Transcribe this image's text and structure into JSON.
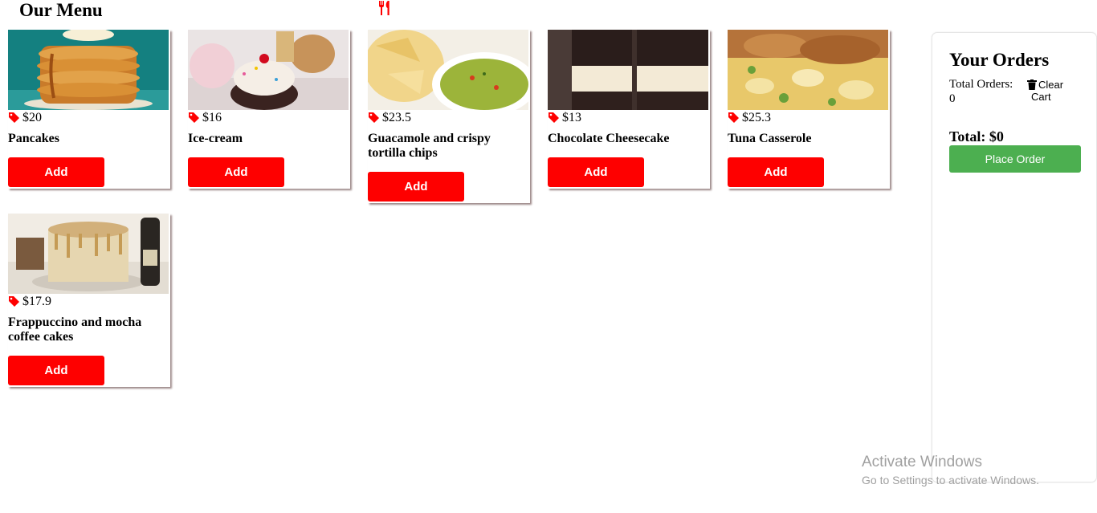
{
  "header": {
    "title": "Our Menu",
    "icon": "fork-knife-icon"
  },
  "menu": {
    "add_label": "Add",
    "price_icon": "price-tag-icon",
    "items": [
      {
        "price": "$20",
        "name": "Pancakes",
        "image": "pancakes"
      },
      {
        "price": "$16",
        "name": "Ice-cream",
        "image": "ice-cream"
      },
      {
        "price": "$23.5",
        "name": "Guacamole and crispy tortilla chips",
        "image": "guacamole-chips"
      },
      {
        "price": "$13",
        "name": "Chocolate Cheesecake",
        "image": "chocolate-cheesecake"
      },
      {
        "price": "$25.3",
        "name": "Tuna Casserole",
        "image": "tuna-casserole"
      },
      {
        "price": "$17.9",
        "name": "Frappuccino and mocha coffee cakes",
        "image": "coffee-cake"
      }
    ]
  },
  "orders": {
    "title": "Your Orders",
    "count_label": "Total Orders: 0",
    "clear_line1": "Clear",
    "clear_line2": "Cart",
    "total": "Total: $0",
    "place_order": "Place Order"
  },
  "watermark": {
    "line1": "Activate Windows",
    "line2": "Go to Settings to activate Windows."
  },
  "colors": {
    "accent_red": "#fe0000",
    "place_green": "#4caf50"
  }
}
